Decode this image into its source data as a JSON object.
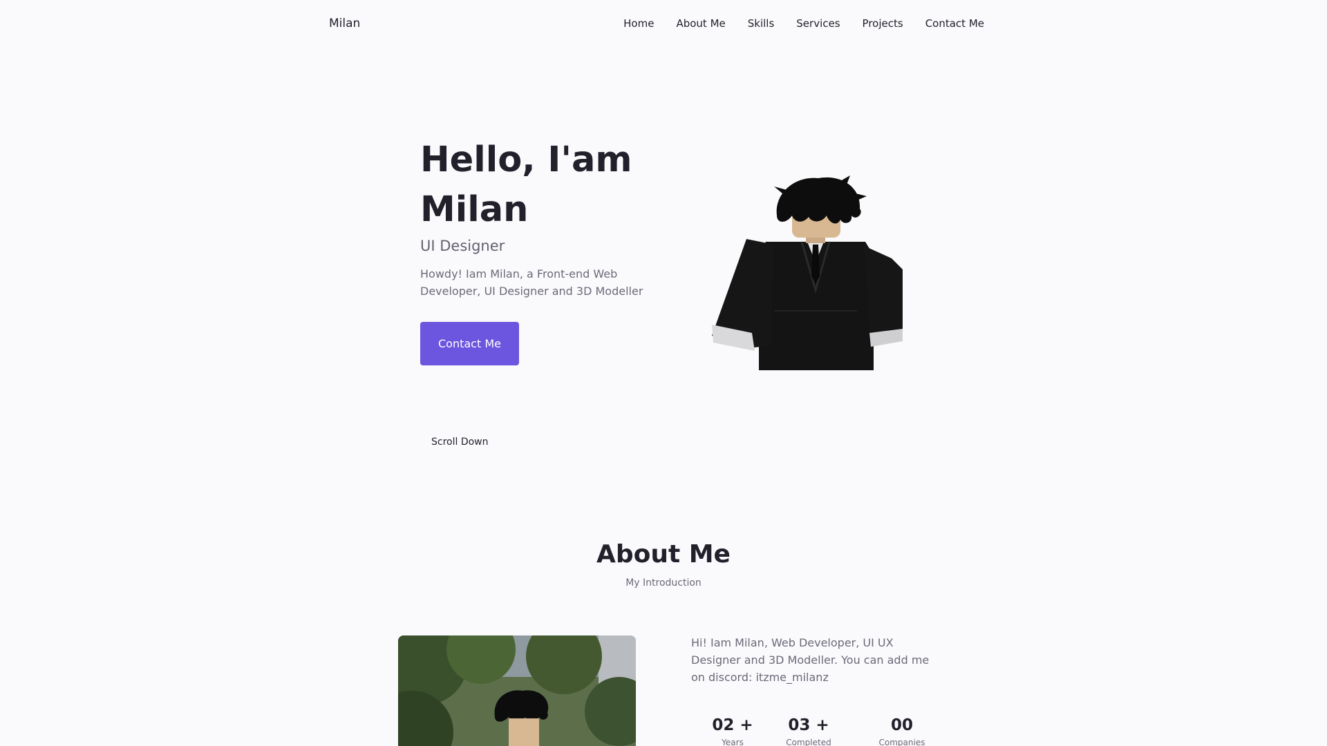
{
  "header": {
    "logo": "Milan",
    "nav": [
      "Home",
      "About Me",
      "Skills",
      "Services",
      "Projects",
      "Contact Me"
    ]
  },
  "hero": {
    "title_line1": "Hello, I'am",
    "title_line2": "Milan",
    "subtitle": "UI Designer",
    "description": "Howdy! Iam Milan, a Front-end Web Developer, UI Designer and 3D Modeller",
    "button_label": "Contact Me",
    "scroll_label": "Scroll Down"
  },
  "about": {
    "title": "About Me",
    "subtitle": "My Introduction",
    "description": "Hi! Iam Milan, Web Developer, UI UX Designer and 3D Modeller. You can add me on discord: itzme_milanz",
    "stats": [
      {
        "number": "02 +",
        "label": "Years"
      },
      {
        "number": "03 +",
        "label": "Completed"
      },
      {
        "number": "00",
        "label": "Companies"
      }
    ]
  },
  "colors": {
    "accent": "#6c55df",
    "background": "#fafafd",
    "text": "#22212b",
    "muted_text": "#6b6977"
  },
  "icons": [
    "roblox-avatar-image",
    "about-photo-image"
  ]
}
